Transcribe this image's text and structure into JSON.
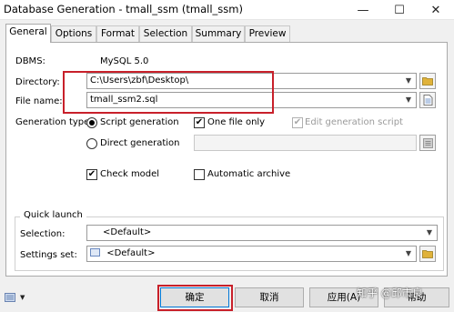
{
  "window": {
    "title": "Database Generation - tmall_ssm (tmall_ssm)",
    "minimize_glyph": "—",
    "maximize_glyph": "☐",
    "close_glyph": "✕"
  },
  "tabs": [
    {
      "label": "General",
      "active": true
    },
    {
      "label": "Options",
      "active": false
    },
    {
      "label": "Format",
      "active": false
    },
    {
      "label": "Selection",
      "active": false
    },
    {
      "label": "Summary",
      "active": false
    },
    {
      "label": "Preview",
      "active": false
    }
  ],
  "general": {
    "dbms_label": "DBMS:",
    "dbms_value": "MySQL 5.0",
    "directory_label": "Directory:",
    "directory_value": "C:\\Users\\zbf\\Desktop\\",
    "filename_label": "File name:",
    "filename_value": "tmall_ssm2.sql",
    "generation_type_label": "Generation type:",
    "script_generation_label": "Script generation",
    "script_generation_selected": true,
    "one_file_only_label": "One file only",
    "one_file_only_checked": true,
    "edit_generation_script_label": "Edit generation script",
    "edit_generation_script_checked": true,
    "direct_generation_label": "Direct generation",
    "direct_generation_selected": false,
    "direct_value": "",
    "check_model_label": "Check model",
    "check_model_checked": true,
    "automatic_archive_label": "Automatic archive",
    "automatic_archive_checked": false
  },
  "quick_launch": {
    "title": "Quick launch",
    "selection_label": "Selection:",
    "selection_value": "<Default>",
    "settings_set_label": "Settings set:",
    "settings_set_value": "<Default>"
  },
  "buttons": {
    "ok": "确定",
    "cancel": "取消",
    "apply": "应用(A)",
    "help": "帮助"
  },
  "watermark": "知乎 @邱市良",
  "colors": {
    "highlight": "#c8202a",
    "folder_icon": "#e0b23a",
    "default_button_border": "#0078d7"
  },
  "icons": {
    "minimize": "minimize-icon",
    "maximize": "maximize-icon",
    "close": "close-icon",
    "folder": "folder-icon",
    "file": "file-icon",
    "settings_menu": "settings-menu-icon"
  }
}
